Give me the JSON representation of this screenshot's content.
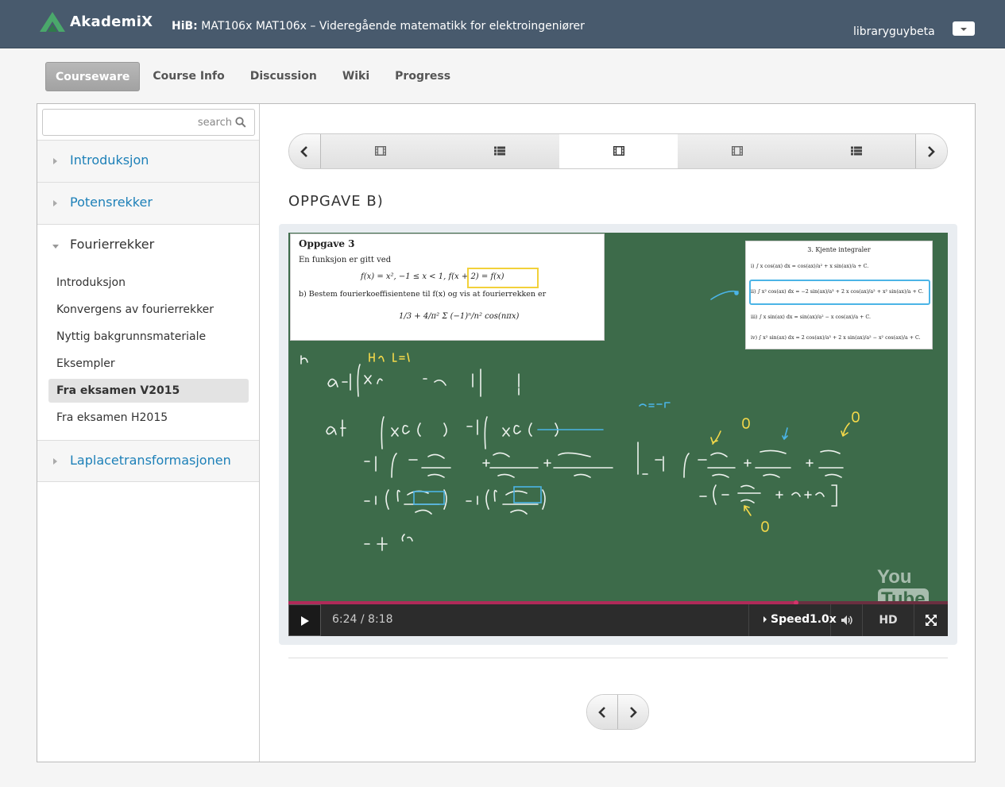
{
  "header": {
    "logo_text": "AkademiX",
    "course_prefix": "HiB:",
    "course_name": "MAT106x MAT106x – Videregående matematikk for elektroingeniører",
    "username": "libraryguybeta"
  },
  "course_tabs": [
    "Courseware",
    "Course Info",
    "Discussion",
    "Wiki",
    "Progress"
  ],
  "sidebar": {
    "search_placeholder": "search",
    "chapters": [
      {
        "label": "Introduksjon"
      },
      {
        "label": "Potensrekker"
      },
      {
        "label": "Fourierrekker",
        "sections": [
          "Introduksjon",
          "Konvergens av fourierrekker",
          "Nyttig bakgrunnsmateriale",
          "Eksempler",
          "Fra eksamen V2015",
          "Fra eksamen H2015"
        ]
      },
      {
        "label": "Laplacetransformasjonen"
      }
    ],
    "active_section": "Fra eksamen V2015"
  },
  "sequence": {
    "tabs": [
      "video-icon",
      "problem-icon",
      "video-icon",
      "video-icon",
      "problem-icon"
    ],
    "active_index": 2
  },
  "unit_title": "OPPGAVE B)",
  "video": {
    "paper_left": {
      "heading": "Oppgave 3",
      "line1": "En funksjon er gitt ved",
      "eq": "f(x) = x², −1 ≤ x < 1,   f(x + 2) = f(x)",
      "line2": "b)  Bestem fourierkoeffisientene til f(x) og vis at fourierrekken er",
      "series": "1/3 + 4/π² Σ (−1)ⁿ/n² cos(nπx)"
    },
    "paper_right": {
      "heading": "3. Kjente integraler",
      "items": [
        "i)  ∫ x cos(ax) dx = cos(ax)/a² + x sin(ax)/a + C.",
        "ii)  ∫ x² cos(ax) dx = −2 sin(ax)/a³ + 2 x cos(ax)/a² + x² sin(ax)/a + C.",
        "iii)  ∫ x sin(ax) dx = sin(ax)/a² − x cos(ax)/a + C.",
        "iv)  ∫ x² sin(ax) dx = 2 cos(ax)/a³ + 2 x sin(ax)/a² − x² cos(ax)/a + C."
      ]
    },
    "watermark": "YouTube",
    "time": "6:24 / 8:18",
    "progress_fraction": 0.7695,
    "speed_label": "Speed",
    "speed_value": "1.0x",
    "hd_label": "HD"
  }
}
